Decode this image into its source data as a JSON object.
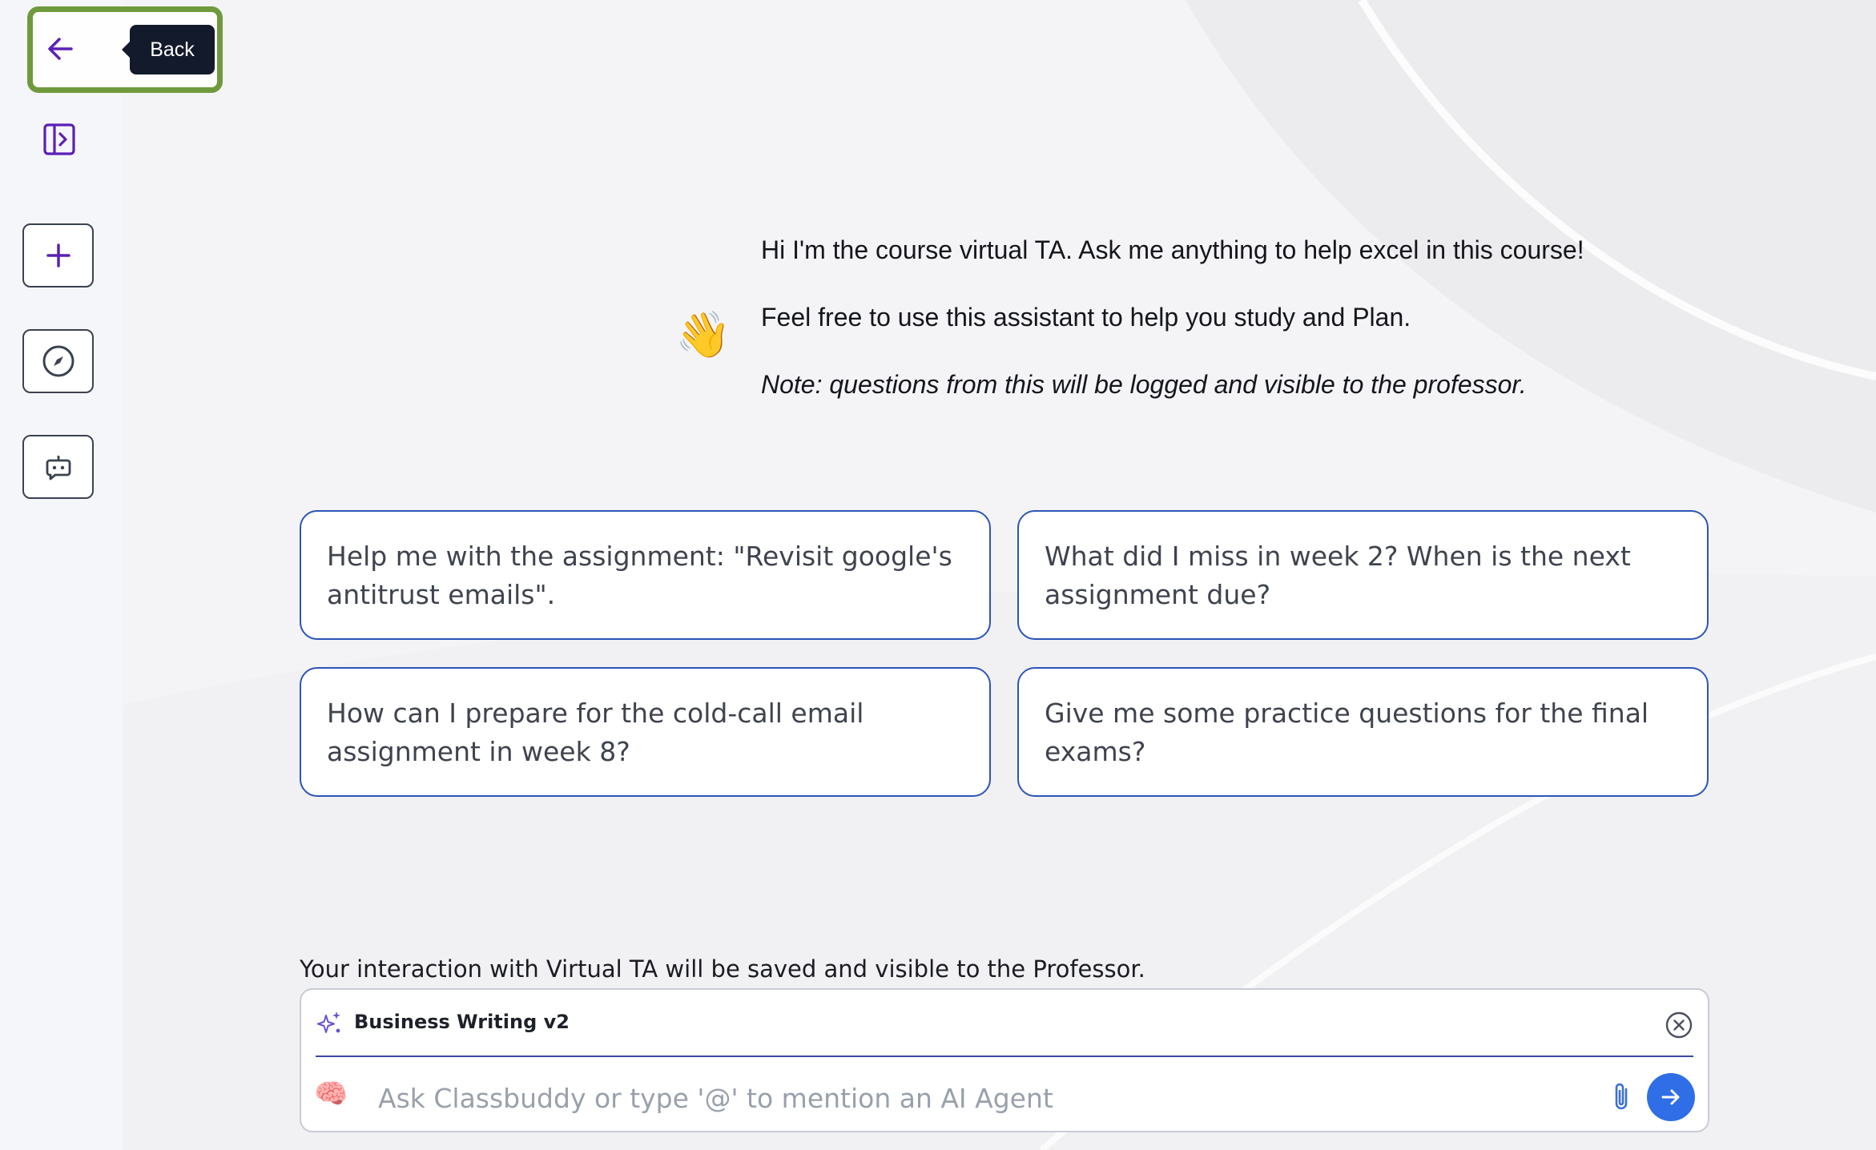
{
  "sidebar": {
    "back_tooltip": "Back",
    "buttons": [
      {
        "name": "back",
        "icon": "arrow-left-icon"
      },
      {
        "name": "toggle-panel",
        "icon": "sidebar-expand-icon"
      },
      {
        "name": "new-chat",
        "icon": "plus-icon"
      },
      {
        "name": "explore",
        "icon": "compass-icon"
      },
      {
        "name": "agents",
        "icon": "bot-chat-icon"
      }
    ]
  },
  "intro": {
    "emoji": "👋",
    "line1": "Hi I'm the course virtual TA. Ask me anything to help excel in this course!",
    "line2": "Feel free to use this assistant to help you study and Plan.",
    "note": "Note: questions from this will be logged and visible to the professor."
  },
  "suggestions": [
    "Help me with the assignment: \"Revisit google's antitrust emails\".",
    "What did I miss in week 2? When is the next assignment due?",
    "How can I prepare for the cold-call email assignment in week 8?",
    "Give me some practice questions for the final exams?"
  ],
  "disclaimer": "Your interaction with Virtual TA will be saved and visible to the Professor.",
  "composer": {
    "agent_name": "Business Writing v2",
    "placeholder": "Ask Classbuddy or type '@' to mention an AI Agent",
    "brain_emoji": "🧠"
  },
  "colors": {
    "accent_purple": "#5b21b6",
    "highlight_green": "#6f9a3c",
    "card_border": "#2b55b8",
    "send_button": "#2f6ee6",
    "tooltip_bg": "#131a2c"
  }
}
